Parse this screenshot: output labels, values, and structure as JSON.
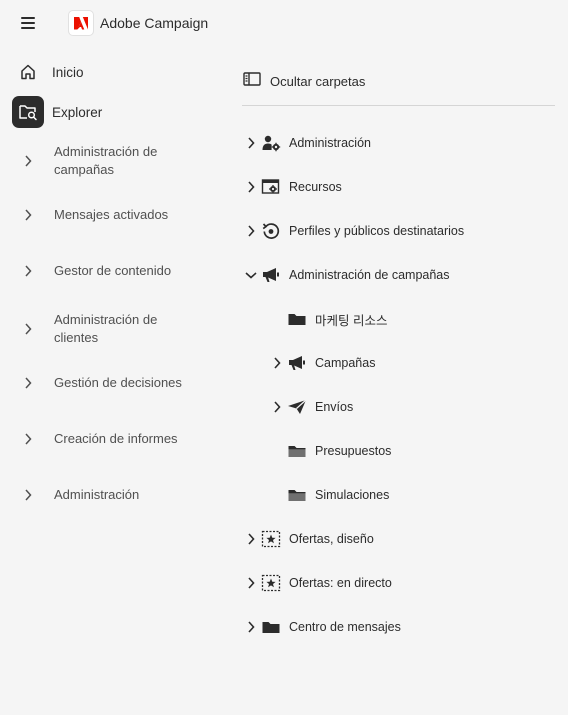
{
  "header": {
    "menu_icon": "hamburger-icon",
    "logo_icon": "adobe-logo-icon",
    "brand_color": "#eb1000",
    "title": "Adobe Campaign"
  },
  "sidebar": {
    "home": {
      "label": "Inicio",
      "icon": "home-icon"
    },
    "explorer": {
      "label": "Explorer",
      "icon": "folder-search-icon",
      "active": true
    },
    "items": [
      {
        "label": "Administración de campañas"
      },
      {
        "label": "Mensajes activados"
      },
      {
        "label": "Gestor de contenido"
      },
      {
        "label": "Administración de clientes"
      },
      {
        "label": "Gestión de decisiones"
      },
      {
        "label": "Creación de informes"
      },
      {
        "label": "Administración"
      }
    ]
  },
  "panel": {
    "hide_folders_label": "Ocultar carpetas",
    "hide_folders_icon": "panel-toggle-icon",
    "tree": [
      {
        "label": "Administración",
        "icon": "user-gear-icon",
        "expanded": false
      },
      {
        "label": "Recursos",
        "icon": "window-gear-icon",
        "expanded": false
      },
      {
        "label": "Perfiles y públicos destinatarios",
        "icon": "refresh-target-icon",
        "expanded": false
      },
      {
        "label": "Administración de campañas",
        "icon": "megaphone-icon",
        "expanded": true,
        "children": [
          {
            "label": "마케팅 리소스",
            "icon": "folder-icon"
          },
          {
            "label": "Campañas",
            "icon": "megaphone-icon",
            "has_children": true
          },
          {
            "label": "Envíos",
            "icon": "paper-plane-icon",
            "has_children": true
          },
          {
            "label": "Presupuestos",
            "icon": "folder-grey-icon"
          },
          {
            "label": "Simulaciones",
            "icon": "folder-grey-icon"
          }
        ]
      },
      {
        "label": "Ofertas, diseño",
        "icon": "star-box-icon",
        "expanded": false
      },
      {
        "label": "Ofertas: en directo",
        "icon": "star-box-icon",
        "expanded": false
      },
      {
        "label": "Centro de mensajes",
        "icon": "folder-icon",
        "expanded": false
      }
    ]
  }
}
